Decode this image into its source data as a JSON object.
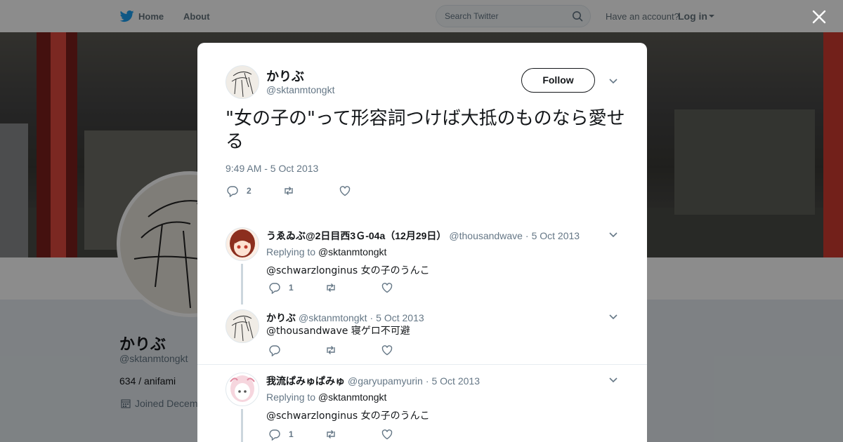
{
  "nav": {
    "home": "Home",
    "about": "About",
    "search_placeholder": "Search Twitter",
    "account_prompt": "Have an account?",
    "login": "Log in"
  },
  "profile": {
    "name": "かりぶ",
    "handle": "@sktanmtongkt",
    "bio": "634 / anifami",
    "joined": "Joined Decem"
  },
  "tweet": {
    "name": "かりぶ",
    "handle": "@sktanmtongkt",
    "follow_label": "Follow",
    "text": "\"女の子の\"って形容詞つけば大抵のものなら愛せる",
    "time": "9:49 AM - 5 Oct 2013",
    "reply_count": "2"
  },
  "replies": [
    {
      "name": "うゑゐぶ@2日目西3Ｇ-04a（12月29日）",
      "handle": "@thousandwave",
      "date": "5 Oct 2013",
      "replying_label": "Replying to",
      "replying_to": "@sktanmtongkt",
      "text": "@schwarzlonginus 女の子のうんこ",
      "reply_count": "1"
    },
    {
      "name": "かりぶ",
      "handle": "@sktanmtongkt",
      "date": "5 Oct 2013",
      "text": "@thousandwave 寝ゲロ不可避"
    },
    {
      "name": "我流ぱみゅぱみゅ",
      "handle": "@garyupamyurin",
      "date": "5 Oct 2013",
      "replying_label": "Replying to",
      "replying_to": "@sktanmtongkt",
      "text": "@schwarzlonginus 女の子のうんこ",
      "reply_count": "1"
    }
  ],
  "icons": [
    "twitter-bird-icon",
    "search-icon",
    "close-icon",
    "chevron-down-icon",
    "reply-icon",
    "retweet-icon",
    "like-icon",
    "calendar-icon"
  ],
  "colors": {
    "brand": "#1da1f2",
    "text": "#14171a",
    "secondary": "#657786",
    "overlay": "rgba(0,0,0,0.45)"
  }
}
